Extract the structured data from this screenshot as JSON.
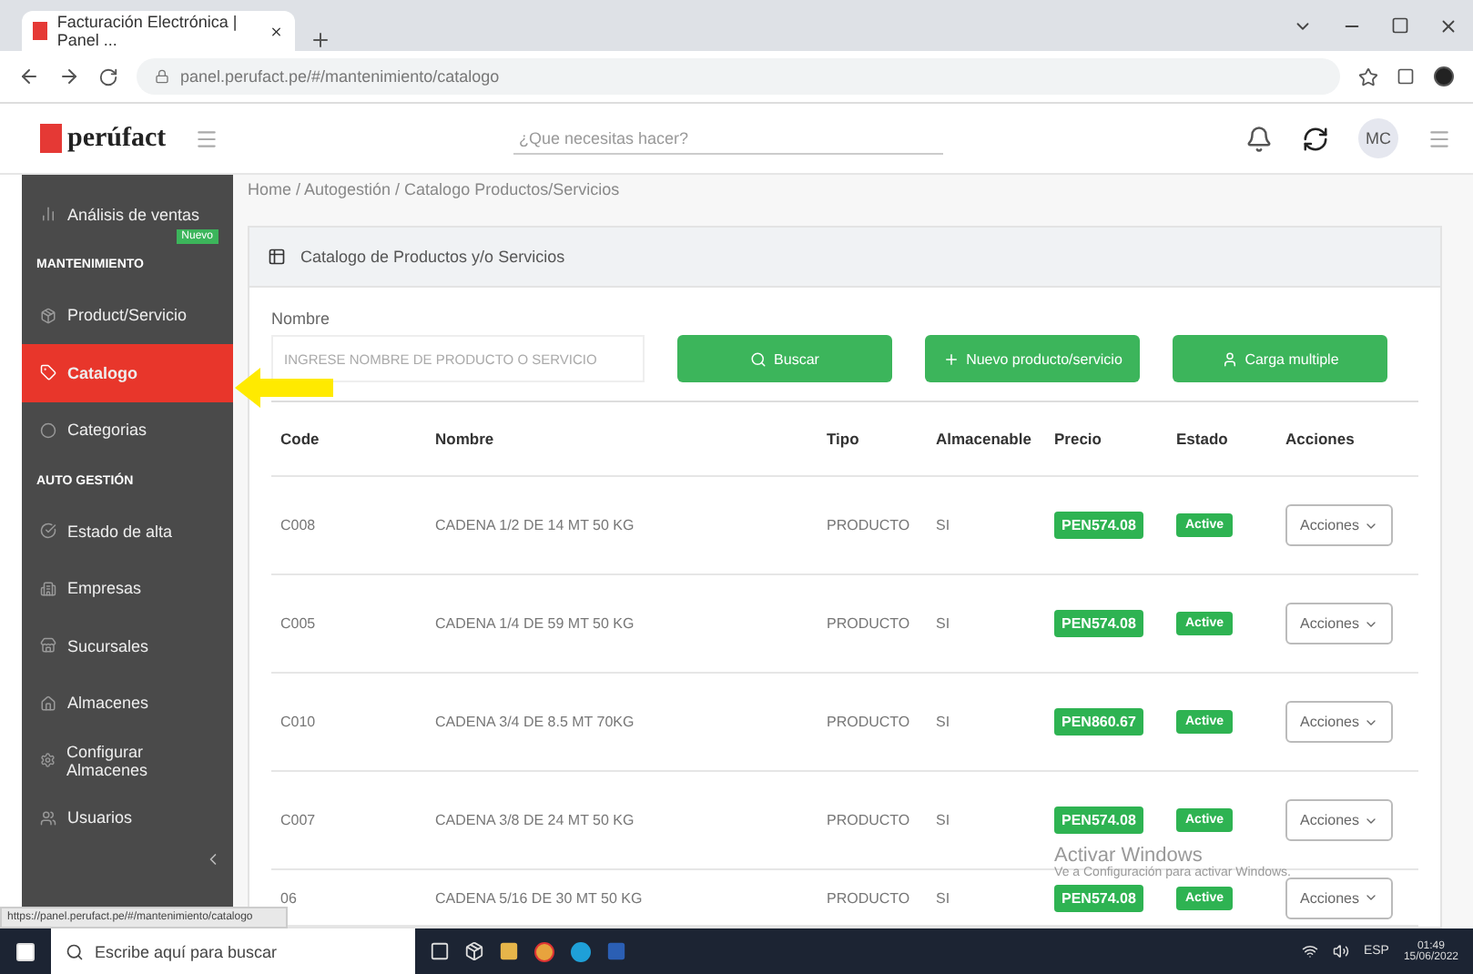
{
  "browser": {
    "tab_title": "Facturación Electrónica | Panel ...",
    "url": "panel.perufact.pe/#/mantenimiento/catalogo"
  },
  "header": {
    "logo": "perúfact",
    "search_placeholder": "¿Que necesitas hacer?",
    "avatar": "MC"
  },
  "sidebar": {
    "items": [
      {
        "kind": "item",
        "label": "Análisis de ventas",
        "badge": "Nuevo",
        "selected": false
      },
      {
        "kind": "section",
        "label": "MANTENIMIENTO"
      },
      {
        "kind": "item",
        "label": "Product/Servicio",
        "selected": false
      },
      {
        "kind": "item",
        "label": "Catalogo",
        "selected": true
      },
      {
        "kind": "item",
        "label": "Categorias",
        "selected": false
      },
      {
        "kind": "section",
        "label": "AUTO GESTIÓN"
      },
      {
        "kind": "item",
        "label": "Estado de alta",
        "selected": false
      },
      {
        "kind": "item",
        "label": "Empresas",
        "selected": false
      },
      {
        "kind": "item",
        "label": "Sucursales",
        "selected": false
      },
      {
        "kind": "item",
        "label": "Almacenes",
        "selected": false
      },
      {
        "kind": "item",
        "label": "Configurar Almacenes",
        "selected": false
      },
      {
        "kind": "item",
        "label": "Usuarios",
        "selected": false
      }
    ]
  },
  "breadcrumb": "Home / Autogestión / Catalogo Productos/Servicios",
  "card": {
    "title": "Catalogo de Productos y/o Servicios",
    "field_label": "Nombre",
    "field_placeholder": "INGRESE NOMBRE DE PRODUCTO O SERVICIO",
    "buttons": [
      "Buscar",
      "Nuevo producto/servicio",
      "Carga multiple"
    ]
  },
  "table": {
    "columns": [
      "Code",
      "Nombre",
      "Tipo",
      "Almacenable",
      "Precio",
      "Estado",
      "Acciones"
    ],
    "rows": [
      {
        "code": "C008",
        "name": "CADENA 1/2 DE 14 MT 50 KG",
        "type": "PRODUCTO",
        "storable": "SI",
        "price": "PEN574.08",
        "status": "Active",
        "action": "Acciones"
      },
      {
        "code": "C005",
        "name": "CADENA 1/4 DE 59 MT 50 KG",
        "type": "PRODUCTO",
        "storable": "SI",
        "price": "PEN574.08",
        "status": "Active",
        "action": "Acciones"
      },
      {
        "code": "C010",
        "name": "CADENA 3/4 DE 8.5 MT 70KG",
        "type": "PRODUCTO",
        "storable": "SI",
        "price": "PEN860.67",
        "status": "Active",
        "action": "Acciones"
      },
      {
        "code": "C007",
        "name": "CADENA 3/8 DE 24 MT 50 KG",
        "type": "PRODUCTO",
        "storable": "SI",
        "price": "PEN574.08",
        "status": "Active",
        "action": "Acciones"
      },
      {
        "code": "06",
        "name": "CADENA 5/16 DE 30 MT 50 KG",
        "type": "PRODUCTO",
        "storable": "SI",
        "price": "PEN574.08",
        "status": "Active",
        "action": "Acciones"
      }
    ]
  },
  "status_url": "https://panel.perufact.pe/#/mantenimiento/catalogo",
  "windows_notice": {
    "title": "Activar Windows",
    "text": "Ve a Configuración para activar Windows."
  },
  "taskbar": {
    "search_placeholder": "Escribe aquí para buscar",
    "language": "ESP",
    "time": "01:49",
    "date": "15/06/2022"
  }
}
